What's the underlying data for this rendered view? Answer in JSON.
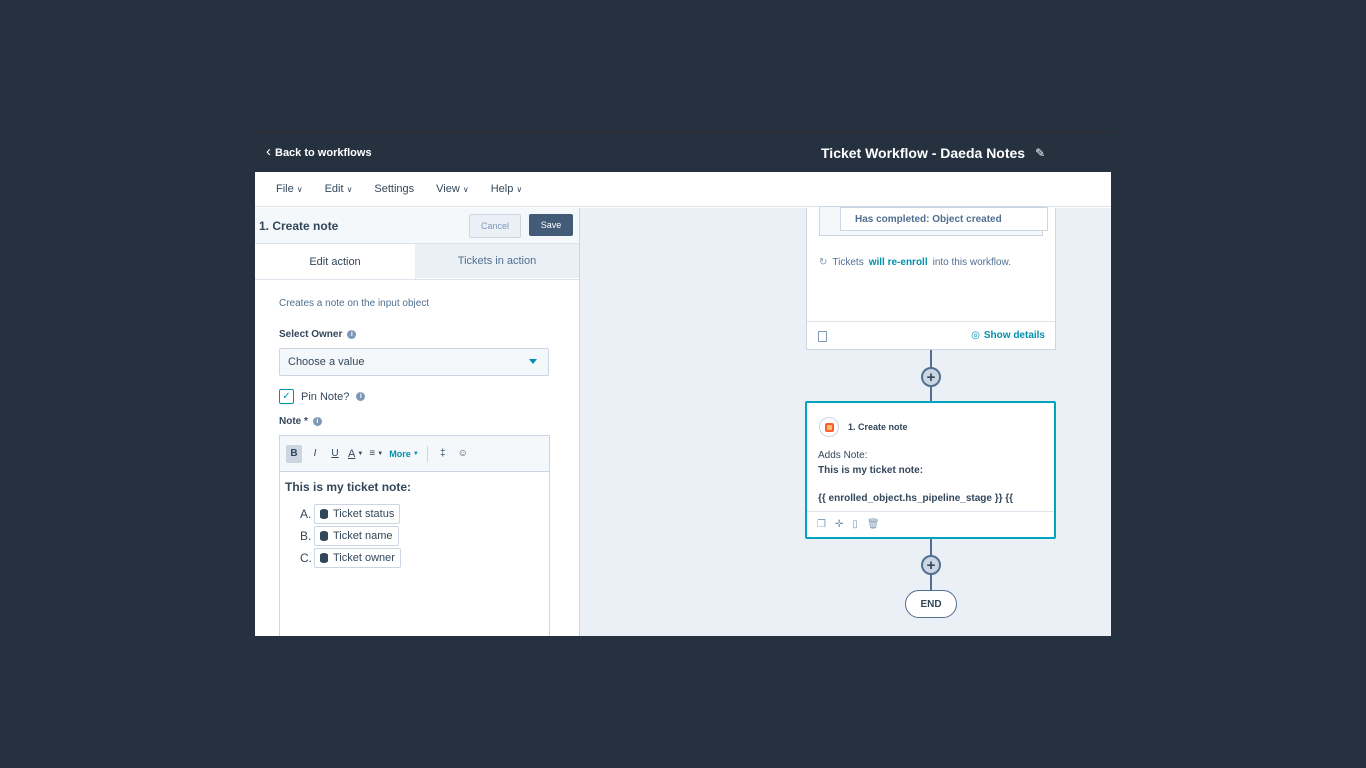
{
  "header": {
    "back_label": "Back to workflows",
    "workflow_title": "Ticket Workflow - Daeda Notes"
  },
  "menu": {
    "items": [
      {
        "label": "File",
        "has_caret": true
      },
      {
        "label": "Edit",
        "has_caret": true
      },
      {
        "label": "Settings",
        "has_caret": false
      },
      {
        "label": "View",
        "has_caret": true
      },
      {
        "label": "Help",
        "has_caret": true
      }
    ]
  },
  "panel": {
    "title": "1. Create note",
    "cancel_label": "Cancel",
    "save_label": "Save",
    "tabs": [
      {
        "label": "Edit action",
        "active": true
      },
      {
        "label": "Tickets in action",
        "active": false
      }
    ],
    "description": "Creates a note on the input object",
    "owner_label": "Select Owner",
    "owner_value": "Choose a value",
    "pin_label": "Pin Note?",
    "pin_checked": true,
    "note_label": "Note *",
    "toolbar": {
      "bold": "B",
      "italic": "I",
      "underline": "U",
      "text_color": "A",
      "more": "More"
    },
    "editor": {
      "heading": "This is my ticket note:",
      "tokens": [
        {
          "letter": "A.",
          "label": "Ticket status"
        },
        {
          "letter": "B.",
          "label": "Ticket name"
        },
        {
          "letter": "C.",
          "label": "Ticket owner"
        }
      ]
    }
  },
  "canvas": {
    "trigger_card": {
      "condition": "Has completed: Object created",
      "reenroll_prefix": "Tickets",
      "reenroll_link": "will re-enroll",
      "reenroll_suffix": "into this workflow.",
      "show_details": "Show details"
    },
    "action_card": {
      "title": "1. Create note",
      "adds_label": "Adds Note:",
      "note_text": "This is my ticket note:",
      "token_text": "{{ enrolled_object.hs_pipeline_stage }} {{"
    },
    "end_label": "END"
  },
  "colors": {
    "backdrop": "#263140",
    "accent": "#0091ae",
    "save_button": "#425b76",
    "selected_card_border": "#00a4bd"
  }
}
